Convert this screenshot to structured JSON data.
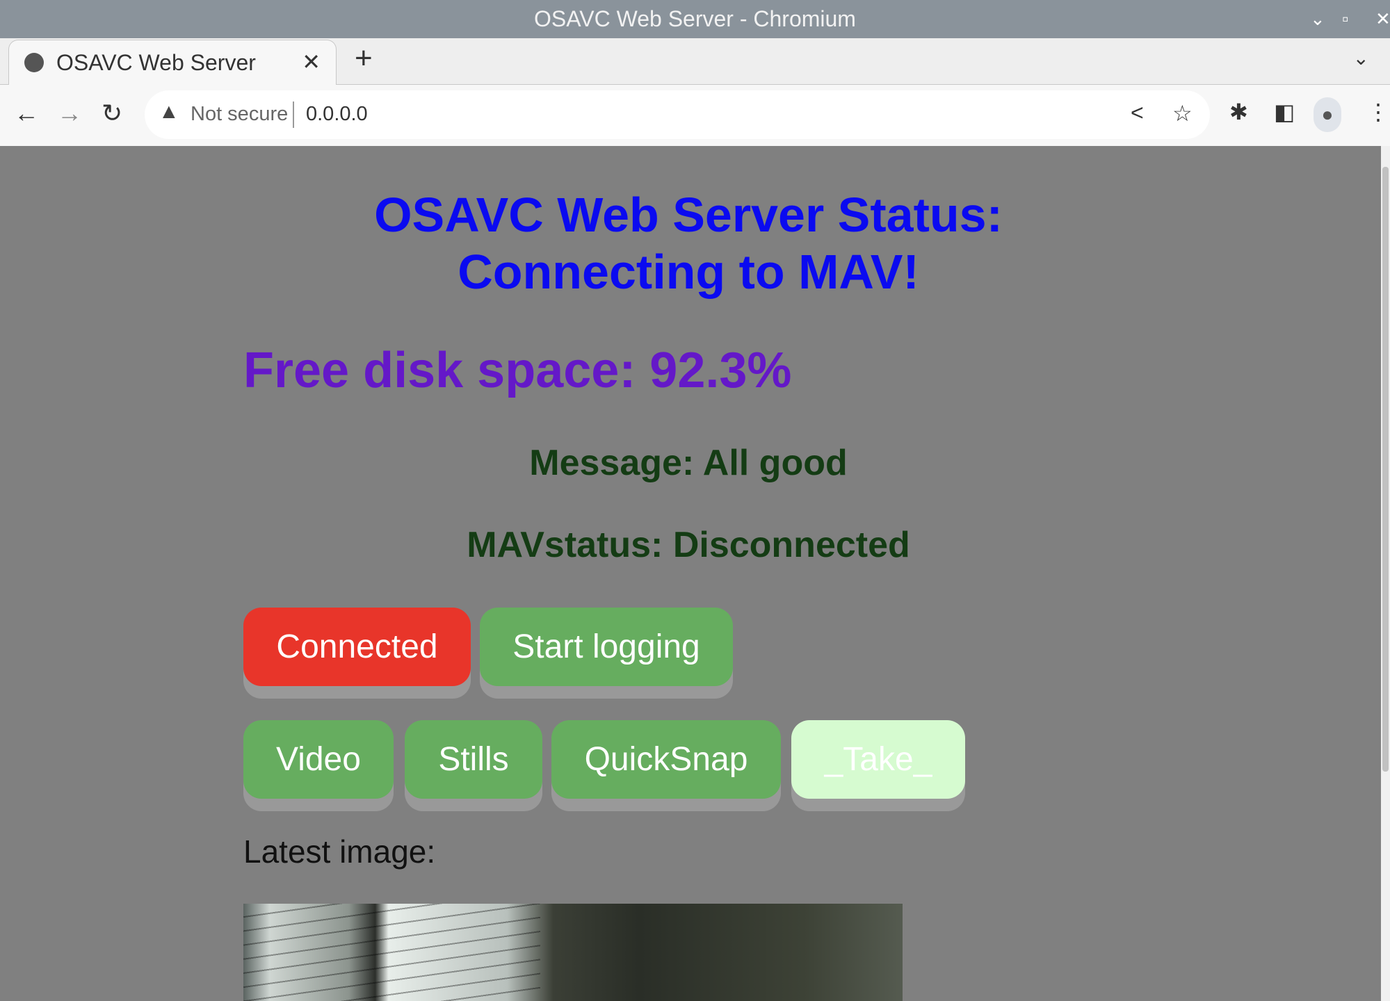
{
  "window": {
    "title": "OSAVC Web Server - Chromium"
  },
  "tab": {
    "title": "OSAVC Web Server"
  },
  "omnibox": {
    "security": "Not secure",
    "url": "0.0.0.0"
  },
  "page": {
    "title_line1": "OSAVC Web Server Status:",
    "title_line2": "Connecting to MAV!",
    "disk": "Free disk space: 92.3%",
    "message": "Message: All good",
    "mavstatus": "MAVstatus: Disconnected",
    "buttons": {
      "connected": "Connected",
      "start_logging": "Start logging",
      "video": "Video",
      "stills": "Stills",
      "quicksnap": "QuickSnap",
      "take": "_Take_"
    },
    "latest_label": "Latest image:"
  },
  "colors": {
    "title": "#0a0af0",
    "disk": "#6418c8",
    "status": "#143c14",
    "red": "#e8352a",
    "green": "#66ad5f",
    "light": "#d6fbd0",
    "background": "#808080"
  }
}
